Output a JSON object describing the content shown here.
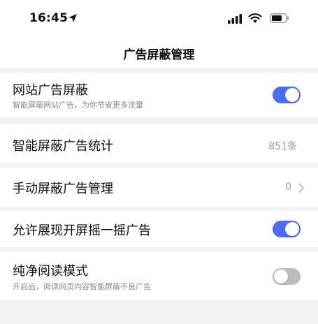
{
  "status_bar": {
    "time": "16:45",
    "icons": [
      "location-arrow-icon",
      "cellular-signal-icon",
      "wifi-icon",
      "battery-icon"
    ]
  },
  "nav": {
    "title": "广告屏蔽管理"
  },
  "colors": {
    "toggle_on": "#4a6cf4",
    "toggle_off": "#bdbdbd",
    "background": "#f2f2f2",
    "row_background": "#ffffff"
  },
  "settings": {
    "website_ad_block": {
      "title": "网站广告屏蔽",
      "subtitle": "智能屏蔽网站广告，为你节省更多流量",
      "enabled": true
    },
    "smart_block_stats": {
      "title": "智能屏蔽广告统计",
      "value": "851条"
    },
    "manual_block": {
      "title": "手动屏蔽广告管理",
      "value": "0"
    },
    "splash_shake_ad": {
      "title": "允许展现开屏摇一摇广告",
      "enabled": true
    },
    "pure_reading": {
      "title": "纯净阅读模式",
      "subtitle": "开启后，阅读网页内容智能屏蔽不良广告",
      "enabled": false
    }
  }
}
